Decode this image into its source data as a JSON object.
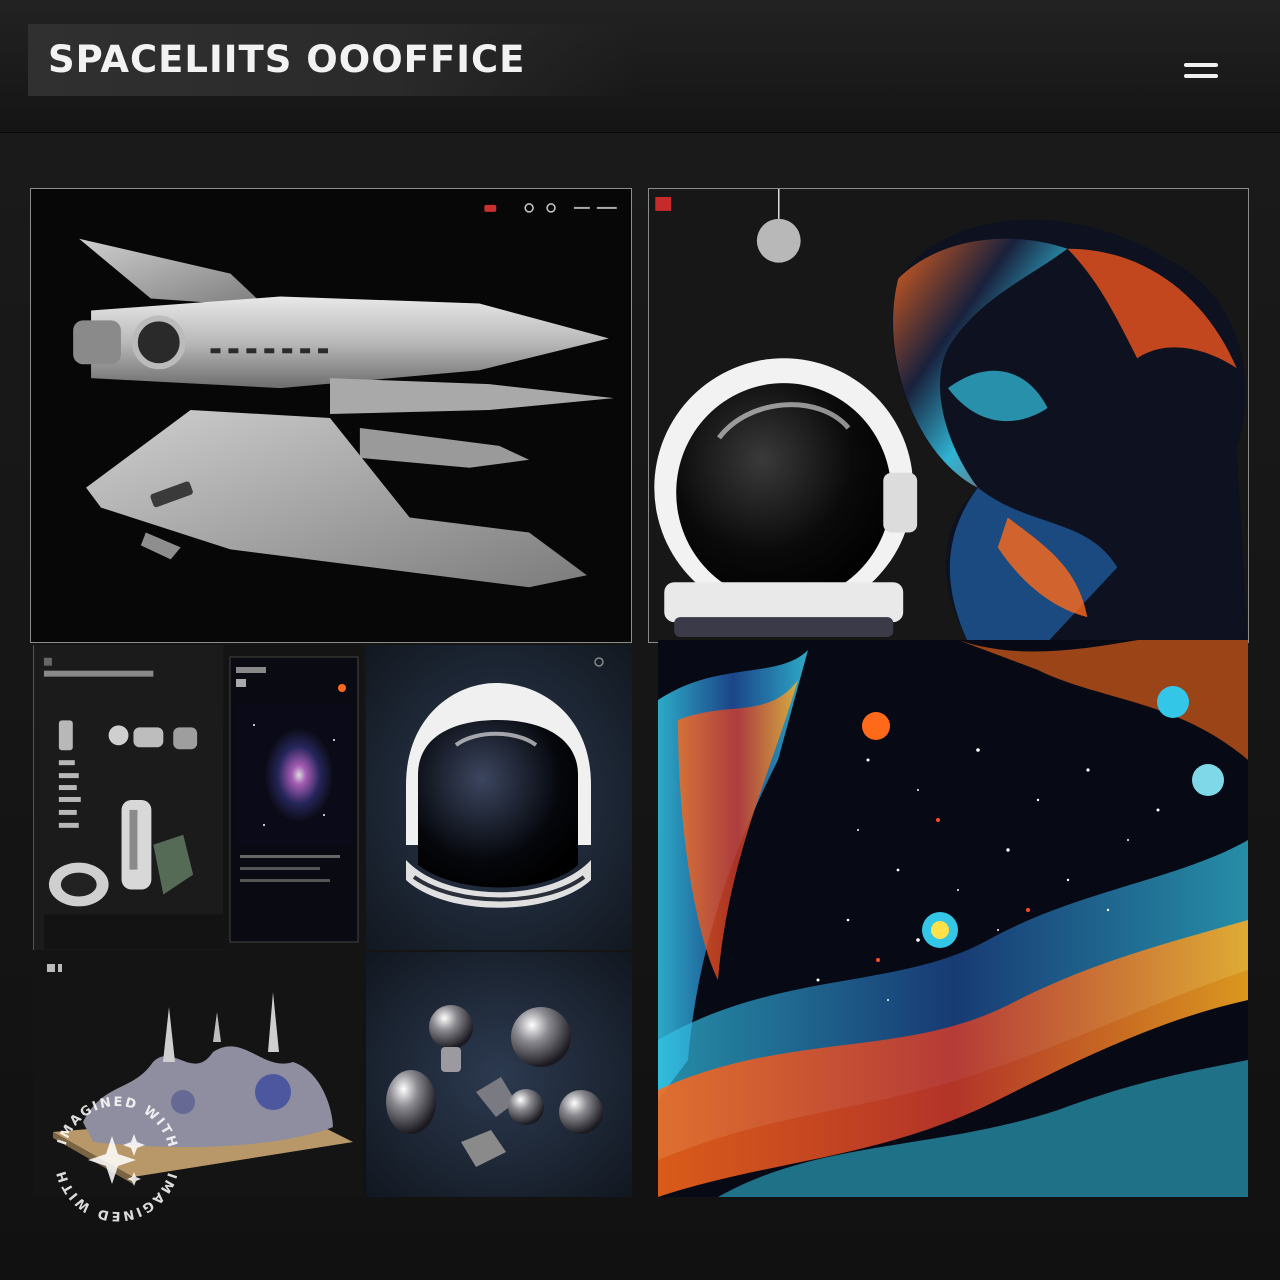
{
  "header": {
    "site_title": "SPACELIITS OOOFFICE",
    "menu_icon": "hamburger-menu-icon"
  },
  "gallery": {
    "tiles": [
      {
        "id": "spaceship",
        "subject": "spaceship-model-image"
      },
      {
        "id": "helmet-scarf",
        "subject": "astronaut-helmet-and-galaxy-scarf-image"
      },
      {
        "id": "gadgets",
        "subject": "space-gadgets-shelf-image"
      },
      {
        "id": "nebula-app",
        "subject": "nebula-phone-screen-image"
      },
      {
        "id": "helmet",
        "subject": "astronaut-helmet-product-image"
      },
      {
        "id": "diorama",
        "subject": "asteroid-diorama-image"
      },
      {
        "id": "ornaments",
        "subject": "metal-sphere-ornaments-image"
      },
      {
        "id": "scarf",
        "subject": "galaxy-print-scarf-image"
      }
    ]
  },
  "watermark": {
    "text_top": "IMAGINED WITH AI",
    "text_bottom": "IMAGINED WITH AI",
    "icon": "sparkle-icon"
  },
  "colors": {
    "background": "#141414",
    "panel_border": "#8c8c8c",
    "accent_orange": "#ff6a1a",
    "accent_cyan": "#33c6e6",
    "title_text": "#f2f2f2"
  }
}
